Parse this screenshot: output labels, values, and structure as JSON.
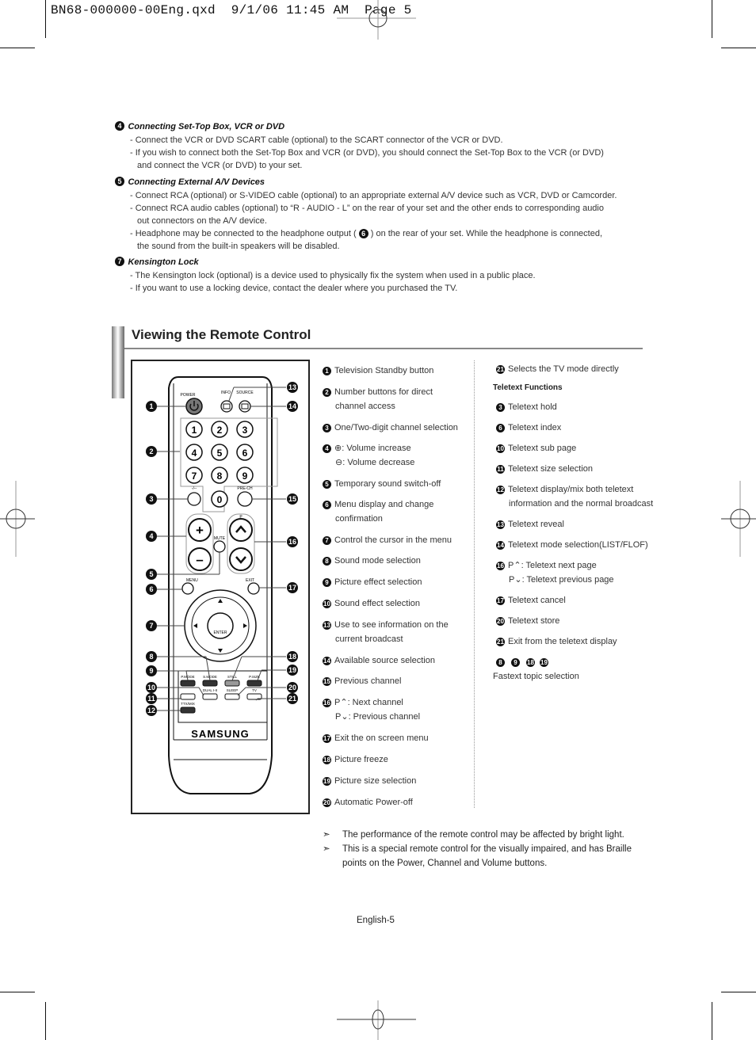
{
  "slug": {
    "file": "BN68-000000-00Eng.qxd",
    "date": "9/1/06",
    "time": "11:45 AM",
    "page_label": "Page 5"
  },
  "connections": [
    {
      "num": "4",
      "heading": "Connecting Set-Top Box, VCR or DVD",
      "bullets": [
        "- Connect the VCR or DVD SCART cable (optional) to the SCART connector of the VCR or DVD.",
        "- If you wish to connect both the Set-Top Box and VCR (or DVD), you should connect the Set-Top Box to the VCR (or DVD)",
        "and connect the VCR (or DVD) to your set."
      ]
    },
    {
      "num": "5",
      "heading": "Connecting External A/V Devices",
      "bullets": [
        "- Connect RCA (optional) or S-VIDEO cable (optional) to an appropriate external A/V device such as VCR, DVD or Camcorder.",
        "- Connect RCA audio cables (optional) to “R - AUDIO - L” on the rear of your set and the other ends to corresponding audio",
        "out connectors on the A/V device.",
        "- Headphone may be connected to the headphone output (",
        ") on the rear of your set. While the headphone is connected,",
        "the sound from the built-in speakers will be disabled."
      ],
      "inline_ref": "6"
    },
    {
      "num": "7",
      "heading": "Kensington Lock",
      "bullets": [
        "- The Kensington lock (optional) is a device used to physically fix the system when used in a public place.",
        "- If you want to use a locking device, contact the dealer where you purchased the TV."
      ]
    }
  ],
  "section_title": "Viewing the Remote Control",
  "remote": {
    "labels": {
      "power": "POWER",
      "info": "INFO",
      "source": "SOURCE",
      "digits": [
        "1",
        "2",
        "3",
        "4",
        "5",
        "6",
        "7",
        "8",
        "9",
        "0"
      ],
      "dash": "-/--",
      "prech": "PRE-CH",
      "p": "P",
      "mute": "MUTE",
      "menu": "MENU",
      "exit": "EXIT",
      "enter": "ENTER",
      "pmode": "P.MODE",
      "smode": "S.MODE",
      "still": "STILL",
      "psize": "P.SIZE",
      "dual": "DUAL I-II",
      "sleep": "SLEEP",
      "tv": "TV",
      "ttx": "TTX/MIX",
      "brand": "SAMSUNG"
    },
    "callouts_left": [
      "1",
      "2",
      "3",
      "4",
      "5",
      "6",
      "7",
      "8",
      "9",
      "10",
      "11",
      "12"
    ],
    "callouts_right": [
      "13",
      "14",
      "15",
      "16",
      "17",
      "18",
      "19",
      "20",
      "21"
    ]
  },
  "functions_col1": [
    {
      "num": "1",
      "lines": [
        "Television Standby button"
      ]
    },
    {
      "num": "2",
      "lines": [
        "Number buttons for direct",
        "channel access"
      ]
    },
    {
      "num": "3",
      "lines": [
        "One/Two-digit channel selection"
      ]
    },
    {
      "num": "4",
      "lines": [
        ": Volume increase",
        ": Volume decrease"
      ]
    },
    {
      "num": "5",
      "lines": [
        "Temporary sound switch-off"
      ]
    },
    {
      "num": "6",
      "lines": [
        "Menu display and  change",
        "confirmation"
      ]
    },
    {
      "num": "7",
      "lines": [
        "Control the cursor in the menu"
      ]
    },
    {
      "num": "8",
      "lines": [
        "Sound mode selection"
      ]
    },
    {
      "num": "9",
      "lines": [
        "Picture effect selection"
      ]
    },
    {
      "num": "10",
      "lines": [
        "Sound effect selection"
      ]
    },
    {
      "num": "13",
      "lines": [
        "Use to see information on the",
        "current broadcast"
      ]
    },
    {
      "num": "14",
      "lines": [
        "Available source selection"
      ]
    },
    {
      "num": "15",
      "lines": [
        "Previous channel"
      ]
    },
    {
      "num": "16",
      "lines": [
        "P",
        ": Next channel",
        "P",
        ": Previous channel"
      ]
    },
    {
      "num": "17",
      "lines": [
        "Exit the on screen menu"
      ]
    },
    {
      "num": "18",
      "lines": [
        "Picture freeze"
      ]
    },
    {
      "num": "19",
      "lines": [
        "Picture size selection"
      ]
    },
    {
      "num": "20",
      "lines": [
        "Automatic Power-off"
      ]
    }
  ],
  "functions_col2": {
    "top": {
      "num": "21",
      "text": "Selects the TV mode directly"
    },
    "teletext_heading": "Teletext Functions",
    "items": [
      {
        "num": "3",
        "lines": [
          "Teletext hold"
        ]
      },
      {
        "num": "6",
        "lines": [
          "Teletext index"
        ]
      },
      {
        "num": "10",
        "lines": [
          "Teletext sub page"
        ]
      },
      {
        "num": "11",
        "lines": [
          "Teletext size selection"
        ]
      },
      {
        "num": "12",
        "lines": [
          "Teletext display/mix both teletext",
          "information and the normal broadcast"
        ]
      },
      {
        "num": "13",
        "lines": [
          "Teletext reveal"
        ]
      },
      {
        "num": "14",
        "lines": [
          "Teletext mode selection(LIST/FLOF)"
        ]
      },
      {
        "num": "16",
        "lines": [
          "P",
          ": Teletext next page",
          "P",
          ": Teletext previous page"
        ]
      },
      {
        "num": "17",
        "lines": [
          "Teletext cancel"
        ]
      },
      {
        "num": "20",
        "lines": [
          "Teletext store"
        ]
      },
      {
        "num": "21",
        "lines": [
          "Exit from the teletext display"
        ]
      }
    ],
    "fastext_nums": [
      "8",
      "9",
      "18",
      "19"
    ],
    "fastext_label": "Fastext topic selection"
  },
  "notes": [
    "The performance of the remote control may be affected by bright light.",
    "This is a special remote control for the visually impaired, and has Braille",
    "points on the Power, Channel and Volume buttons."
  ],
  "footer": "English-5"
}
